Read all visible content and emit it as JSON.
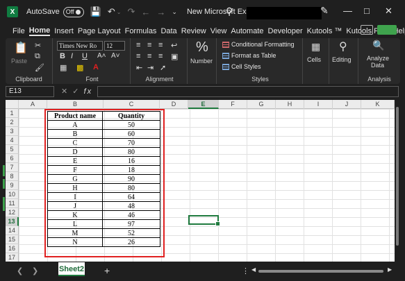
{
  "titlebar": {
    "app_icon": "X",
    "autosave_label": "AutoSave",
    "autosave_state": "Off",
    "save_icon": "save-icon",
    "undo_icon": "undo-icon",
    "redo_icon": "redo-icon",
    "doc_title": "New Microsoft Excel..."
  },
  "tabs": [
    "File",
    "Home",
    "Insert",
    "Page Layout",
    "Formulas",
    "Data",
    "Review",
    "View",
    "Automate",
    "Developer",
    "Kutools ™",
    "Kutools Plus",
    "Help"
  ],
  "active_tab": "Home",
  "ribbon": {
    "clipboard": {
      "paste_label": "Paste",
      "group_label": "Clipboard"
    },
    "font": {
      "font_name": "Times New Ro",
      "font_size": "12",
      "bold": "B",
      "italic": "I",
      "underline": "U",
      "grow": "A˄",
      "shrink": "A˅",
      "group_label": "Font"
    },
    "alignment": {
      "group_label": "Alignment"
    },
    "number": {
      "symbol": "%",
      "label": "Number"
    },
    "styles": {
      "conditional": "Conditional Formatting",
      "format_table": "Format as Table",
      "cell_styles": "Cell Styles",
      "group_label": "Styles"
    },
    "cells": {
      "label": "Cells"
    },
    "editing": {
      "label": "Editing"
    },
    "analysis": {
      "analyze_line1": "Analyze",
      "analyze_line2": "Data",
      "group_label": "Analysis"
    }
  },
  "formula_bar": {
    "name_box": "E13",
    "fx": "fx",
    "value": ""
  },
  "columns": [
    "A",
    "B",
    "C",
    "D",
    "E",
    "F",
    "G",
    "H",
    "I",
    "J",
    "K"
  ],
  "selected_column": "E",
  "rows": [
    "1",
    "2",
    "3",
    "4",
    "5",
    "6",
    "7",
    "8",
    "9",
    "10",
    "11",
    "12",
    "13",
    "14",
    "15",
    "16",
    "17"
  ],
  "selected_row": "13",
  "table": {
    "headers": [
      "Product name",
      "Quantity"
    ],
    "rows": [
      [
        "A",
        "50"
      ],
      [
        "B",
        "60"
      ],
      [
        "C",
        "70"
      ],
      [
        "D",
        "80"
      ],
      [
        "E",
        "16"
      ],
      [
        "F",
        "18"
      ],
      [
        "G",
        "90"
      ],
      [
        "H",
        "80"
      ],
      [
        "I",
        "64"
      ],
      [
        "J",
        "48"
      ],
      [
        "K",
        "46"
      ],
      [
        "L",
        "97"
      ],
      [
        "M",
        "52"
      ],
      [
        "N",
        "26"
      ]
    ]
  },
  "sheet": {
    "active": "Sheet2",
    "add": "+"
  },
  "colors": {
    "accent": "#1f7a3e",
    "highlight_box": "#e02020"
  }
}
